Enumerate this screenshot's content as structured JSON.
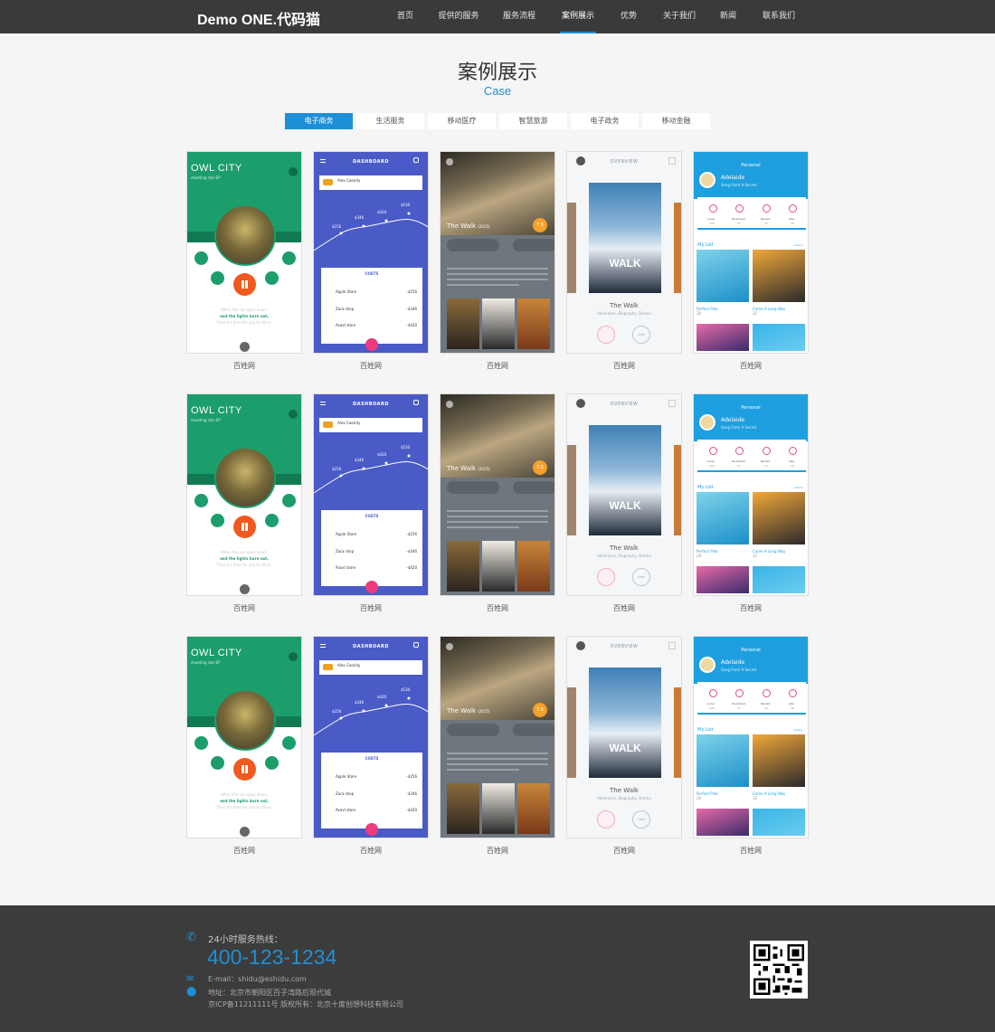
{
  "header": {
    "logo": "Demo ONE.代码猫",
    "nav": [
      "首页",
      "提供的服务",
      "服务流程",
      "案例展示",
      "优势",
      "关于我们",
      "新闻",
      "联系我们"
    ],
    "active_index": 3,
    "accent_color": "#1e8fd6"
  },
  "section": {
    "title": "案例展示",
    "subtitle": "Case"
  },
  "tabs": {
    "items": [
      "电子商务",
      "生活服务",
      "移动医疗",
      "智慧旅游",
      "电子政务",
      "移动金融"
    ],
    "active_index": 0
  },
  "cases": {
    "rows": [
      [
        "百姓网",
        "百姓网",
        "百姓网",
        "百姓网",
        "百姓网"
      ],
      [
        "百姓网",
        "百姓网",
        "百姓网",
        "百姓网",
        "百姓网"
      ],
      [
        "百姓网",
        "百姓网",
        "百姓网",
        "百姓网",
        "百姓网"
      ]
    ]
  },
  "screens": {
    "music": {
      "title": "OWL CITY",
      "subtitle": "shooting star EP",
      "status": "VIRGIN  3G",
      "time": "4:20",
      "lyrics": [
        "When the sun goes down,",
        "and the lights burn out,",
        "Then it's time for you to shine."
      ]
    },
    "dashboard": {
      "title": "DASHBOARD",
      "card_name": "Alex Cassidy",
      "chart_values": [
        "$256",
        "$346",
        "$420",
        "$530"
      ],
      "costs_title": "COSTS",
      "costs": [
        {
          "label": "Apple Store",
          "amount": "-$256"
        },
        {
          "label": "Zara shop",
          "amount": "-$346"
        },
        {
          "label": "Avaxl store",
          "amount": "-$420"
        }
      ]
    },
    "movie": {
      "title": "The Walk",
      "year": "(2015)",
      "score": "7.5"
    },
    "overview": {
      "title": "OVERVIEW",
      "poster_text": "WALK",
      "name": "The Walk",
      "genre": "Adventure, Biography, Drama",
      "view_label": "VIEW"
    },
    "personal": {
      "title": "Personal",
      "name": "Adelaide",
      "song": "Song From A Secret",
      "stats": [
        {
          "label": "Local",
          "value": "126"
        },
        {
          "label": "Download",
          "value": "47"
        },
        {
          "label": "Recent",
          "value": "19"
        },
        {
          "label": "Like",
          "value": "28"
        }
      ],
      "list_title": "My List",
      "more": "+more",
      "items": [
        {
          "label": "Perfect Pink",
          "count": "28"
        },
        {
          "label": "Came A Long Way",
          "count": "32"
        }
      ]
    }
  },
  "footer": {
    "hotline_label": "24小时服务热线：",
    "phone": "400-123-1234",
    "email": "E-mail：shidu@eshidu.com",
    "address": "地址：北京市朝阳区百子湾路后现代城",
    "icp": "京ICP备11211111号  版权所有：北京十度创想科技有限公司"
  }
}
